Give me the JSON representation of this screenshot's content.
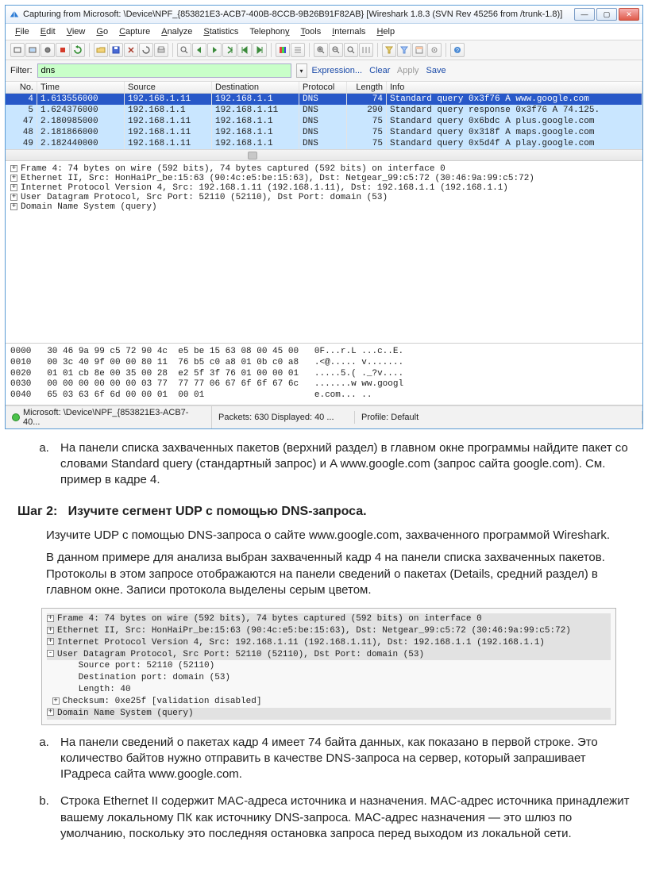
{
  "window": {
    "title": "Capturing from Microsoft: \\Device\\NPF_{853821E3-ACB7-400B-8CCB-9B26B91F82AB}   [Wireshark 1.8.3  (SVN Rev 45256 from /trunk-1.8)]",
    "min": "—",
    "max": "▢",
    "close": "✕"
  },
  "menu": {
    "file": "File",
    "edit": "Edit",
    "view": "View",
    "go": "Go",
    "capture": "Capture",
    "analyze": "Analyze",
    "statistics": "Statistics",
    "telephony": "Telephony",
    "tools": "Tools",
    "internals": "Internals",
    "help": "Help"
  },
  "filter": {
    "label": "Filter:",
    "value": "dns",
    "links": {
      "expr": "Expression...",
      "clear": "Clear",
      "apply": "Apply",
      "save": "Save"
    }
  },
  "packet_list": {
    "headers": {
      "no": "No.",
      "time": "Time",
      "src": "Source",
      "dst": "Destination",
      "proto": "Protocol",
      "len": "Length",
      "info": "Info"
    },
    "rows": [
      {
        "no": "4",
        "time": "1.613556000",
        "src": "192.168.1.11",
        "dst": "192.168.1.1",
        "proto": "DNS",
        "len": "74",
        "info": "Standard query 0x3f76  A www.google.com",
        "sel": true
      },
      {
        "no": "5",
        "time": "1.624376000",
        "src": "192.168.1.1",
        "dst": "192.168.1.11",
        "proto": "DNS",
        "len": "290",
        "info": "Standard query response 0x3f76  A 74.125."
      },
      {
        "no": "47",
        "time": "2.180985000",
        "src": "192.168.1.11",
        "dst": "192.168.1.1",
        "proto": "DNS",
        "len": "75",
        "info": "Standard query 0x6bdc  A plus.google.com"
      },
      {
        "no": "48",
        "time": "2.181866000",
        "src": "192.168.1.11",
        "dst": "192.168.1.1",
        "proto": "DNS",
        "len": "75",
        "info": "Standard query 0x318f  A maps.google.com"
      },
      {
        "no": "49",
        "time": "2.182440000",
        "src": "192.168.1.11",
        "dst": "192.168.1.1",
        "proto": "DNS",
        "len": "75",
        "info": "Standard query 0x5d4f  A play.google.com"
      }
    ]
  },
  "details_main": [
    "Frame 4: 74 bytes on wire (592 bits), 74 bytes captured (592 bits) on interface 0",
    "Ethernet II, Src: HonHaiPr_be:15:63 (90:4c:e5:be:15:63), Dst: Netgear_99:c5:72 (30:46:9a:99:c5:72)",
    "Internet Protocol Version 4, Src: 192.168.1.11 (192.168.1.11), Dst: 192.168.1.1 (192.168.1.1)",
    "User Datagram Protocol, Src Port: 52110 (52110), Dst Port: domain (53)",
    "Domain Name System (query)"
  ],
  "hex_pane": "0000   30 46 9a 99 c5 72 90 4c  e5 be 15 63 08 00 45 00   0F...r.L ...c..E.\n0010   00 3c 40 9f 00 00 80 11  76 b5 c0 a8 01 0b c0 a8   .<@..... v.......\n0020   01 01 cb 8e 00 35 00 28  e2 5f 3f 76 01 00 00 01   .....5.( ._?v....\n0030   00 00 00 00 00 00 03 77  77 77 06 67 6f 6f 67 6c   .......w ww.googl\n0040   65 03 63 6f 6d 00 00 01  00 01                     e.com... ..",
  "statusbar": {
    "left": "Microsoft: \\Device\\NPF_{853821E3-ACB7-40...",
    "mid": "Packets: 630 Displayed: 40 ...",
    "profile": "Profile: Default"
  },
  "doc": {
    "item_a1": "На панели списка захваченных пакетов (верхний раздел) в главном окне программы найдите пакет со словами Standard query (стандартный запрос) и A www.google.com (запрос сайта google.com). См. пример в кадре 4.",
    "step2_label": "Шаг 2:",
    "step2_title": "Изучите сегмент UDP с помощью DNS-запроса.",
    "para1": "Изучите UDP с помощью DNS-запроса о сайте www.google.com, захваченного программой Wireshark.",
    "para2": "В данном примере для анализа выбран захваченный кадр 4 на панели списка захваченных пакетов. Протоколы в этом запросе отображаются на панели сведений о пакетах (Details, средний раздел) в главном окне. Записи протокола выделены серым цветом.",
    "item_a2": "На панели сведений о пакетах кадр 4 имеет 74 байта данных, как показано в первой строке. Это количество байтов нужно отправить в качестве DNS-запроса на сервер, который запрашивает IPадреса сайта www.google.com.",
    "item_b2": "Строка Ethernet II содержит MAC-адреса источника и назначения. MAC-адрес источника принадлежит вашему локальному ПК как источнику DNS-запроса. MAC-адрес назначения — это шлюз по умолчанию, поскольку это последняя остановка запроса перед выходом из локальной сети."
  },
  "details_box": {
    "lines": [
      {
        "t": "Frame 4: 74 bytes on wire (592 bits), 74 bytes captured (592 bits) on interface 0",
        "btn": "+",
        "hl": true
      },
      {
        "t": "Ethernet II, Src: HonHaiPr_be:15:63 (90:4c:e5:be:15:63), Dst: Netgear_99:c5:72 (30:46:9a:99:c5:72)",
        "btn": "+",
        "hl": true
      },
      {
        "t": "Internet Protocol Version 4, Src: 192.168.1.11 (192.168.1.11), Dst: 192.168.1.1 (192.168.1.1)",
        "btn": "+",
        "hl": true
      },
      {
        "t": "User Datagram Protocol, Src Port: 52110 (52110), Dst Port: domain (53)",
        "btn": "-",
        "hl": true
      },
      {
        "t": "   Source port: 52110 (52110)",
        "btn": "",
        "hl": false
      },
      {
        "t": "   Destination port: domain (53)",
        "btn": "",
        "hl": false
      },
      {
        "t": "   Length: 40",
        "btn": "",
        "hl": false
      },
      {
        "t": "Checksum: 0xe25f [validation disabled]",
        "btn": "+",
        "hl": false,
        "indent": true
      },
      {
        "t": "Domain Name System (query)",
        "btn": "+",
        "hl": true
      }
    ]
  }
}
